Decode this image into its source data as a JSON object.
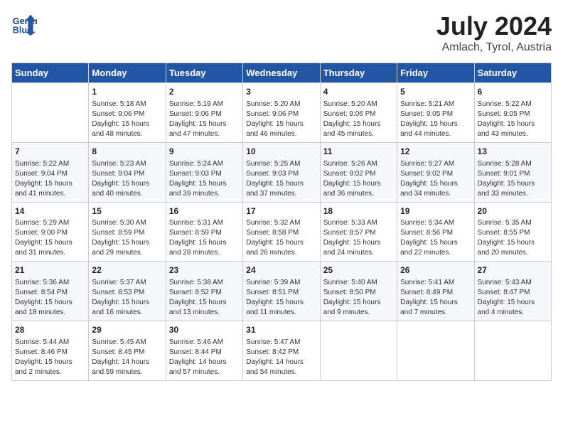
{
  "header": {
    "logo_line1": "General",
    "logo_line2": "Blue",
    "month_year": "July 2024",
    "location": "Amlach, Tyrol, Austria"
  },
  "days_of_week": [
    "Sunday",
    "Monday",
    "Tuesday",
    "Wednesday",
    "Thursday",
    "Friday",
    "Saturday"
  ],
  "weeks": [
    [
      {
        "day": "",
        "info": ""
      },
      {
        "day": "1",
        "info": "Sunrise: 5:18 AM\nSunset: 9:06 PM\nDaylight: 15 hours\nand 48 minutes."
      },
      {
        "day": "2",
        "info": "Sunrise: 5:19 AM\nSunset: 9:06 PM\nDaylight: 15 hours\nand 47 minutes."
      },
      {
        "day": "3",
        "info": "Sunrise: 5:20 AM\nSunset: 9:06 PM\nDaylight: 15 hours\nand 46 minutes."
      },
      {
        "day": "4",
        "info": "Sunrise: 5:20 AM\nSunset: 9:06 PM\nDaylight: 15 hours\nand 45 minutes."
      },
      {
        "day": "5",
        "info": "Sunrise: 5:21 AM\nSunset: 9:05 PM\nDaylight: 15 hours\nand 44 minutes."
      },
      {
        "day": "6",
        "info": "Sunrise: 5:22 AM\nSunset: 9:05 PM\nDaylight: 15 hours\nand 43 minutes."
      }
    ],
    [
      {
        "day": "7",
        "info": "Sunrise: 5:22 AM\nSunset: 9:04 PM\nDaylight: 15 hours\nand 41 minutes."
      },
      {
        "day": "8",
        "info": "Sunrise: 5:23 AM\nSunset: 9:04 PM\nDaylight: 15 hours\nand 40 minutes."
      },
      {
        "day": "9",
        "info": "Sunrise: 5:24 AM\nSunset: 9:03 PM\nDaylight: 15 hours\nand 39 minutes."
      },
      {
        "day": "10",
        "info": "Sunrise: 5:25 AM\nSunset: 9:03 PM\nDaylight: 15 hours\nand 37 minutes."
      },
      {
        "day": "11",
        "info": "Sunrise: 5:26 AM\nSunset: 9:02 PM\nDaylight: 15 hours\nand 36 minutes."
      },
      {
        "day": "12",
        "info": "Sunrise: 5:27 AM\nSunset: 9:02 PM\nDaylight: 15 hours\nand 34 minutes."
      },
      {
        "day": "13",
        "info": "Sunrise: 5:28 AM\nSunset: 9:01 PM\nDaylight: 15 hours\nand 33 minutes."
      }
    ],
    [
      {
        "day": "14",
        "info": "Sunrise: 5:29 AM\nSunset: 9:00 PM\nDaylight: 15 hours\nand 31 minutes."
      },
      {
        "day": "15",
        "info": "Sunrise: 5:30 AM\nSunset: 8:59 PM\nDaylight: 15 hours\nand 29 minutes."
      },
      {
        "day": "16",
        "info": "Sunrise: 5:31 AM\nSunset: 8:59 PM\nDaylight: 15 hours\nand 28 minutes."
      },
      {
        "day": "17",
        "info": "Sunrise: 5:32 AM\nSunset: 8:58 PM\nDaylight: 15 hours\nand 26 minutes."
      },
      {
        "day": "18",
        "info": "Sunrise: 5:33 AM\nSunset: 8:57 PM\nDaylight: 15 hours\nand 24 minutes."
      },
      {
        "day": "19",
        "info": "Sunrise: 5:34 AM\nSunset: 8:56 PM\nDaylight: 15 hours\nand 22 minutes."
      },
      {
        "day": "20",
        "info": "Sunrise: 5:35 AM\nSunset: 8:55 PM\nDaylight: 15 hours\nand 20 minutes."
      }
    ],
    [
      {
        "day": "21",
        "info": "Sunrise: 5:36 AM\nSunset: 8:54 PM\nDaylight: 15 hours\nand 18 minutes."
      },
      {
        "day": "22",
        "info": "Sunrise: 5:37 AM\nSunset: 8:53 PM\nDaylight: 15 hours\nand 16 minutes."
      },
      {
        "day": "23",
        "info": "Sunrise: 5:38 AM\nSunset: 8:52 PM\nDaylight: 15 hours\nand 13 minutes."
      },
      {
        "day": "24",
        "info": "Sunrise: 5:39 AM\nSunset: 8:51 PM\nDaylight: 15 hours\nand 11 minutes."
      },
      {
        "day": "25",
        "info": "Sunrise: 5:40 AM\nSunset: 8:50 PM\nDaylight: 15 hours\nand 9 minutes."
      },
      {
        "day": "26",
        "info": "Sunrise: 5:41 AM\nSunset: 8:49 PM\nDaylight: 15 hours\nand 7 minutes."
      },
      {
        "day": "27",
        "info": "Sunrise: 5:43 AM\nSunset: 8:47 PM\nDaylight: 15 hours\nand 4 minutes."
      }
    ],
    [
      {
        "day": "28",
        "info": "Sunrise: 5:44 AM\nSunset: 8:46 PM\nDaylight: 15 hours\nand 2 minutes."
      },
      {
        "day": "29",
        "info": "Sunrise: 5:45 AM\nSunset: 8:45 PM\nDaylight: 14 hours\nand 59 minutes."
      },
      {
        "day": "30",
        "info": "Sunrise: 5:46 AM\nSunset: 8:44 PM\nDaylight: 14 hours\nand 57 minutes."
      },
      {
        "day": "31",
        "info": "Sunrise: 5:47 AM\nSunset: 8:42 PM\nDaylight: 14 hours\nand 54 minutes."
      },
      {
        "day": "",
        "info": ""
      },
      {
        "day": "",
        "info": ""
      },
      {
        "day": "",
        "info": ""
      }
    ]
  ]
}
